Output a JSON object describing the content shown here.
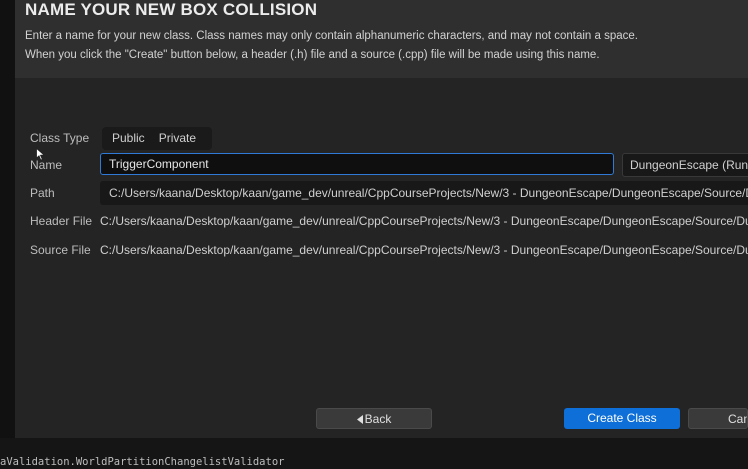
{
  "dialog": {
    "title": "NAME YOUR NEW BOX COLLISION",
    "description_line1": "Enter a name for your new class. Class names may only contain alphanumeric characters, and may not contain a space.",
    "description_line2": "When you click the \"Create\" button below, a header (.h) file and a source (.cpp) file will be made using this name."
  },
  "form": {
    "class_type_label": "Class Type",
    "class_type_options": [
      "Public",
      "Private"
    ],
    "name_label": "Name",
    "name_value": "TriggerComponent",
    "module_value": "DungeonEscape (Runtime)",
    "path_label": "Path",
    "path_value": "C:/Users/kaana/Desktop/kaan/game_dev/unreal/CppCourseProjects/New/3 - DungeonEscape/DungeonEscape/Source/DungeonEscape/",
    "header_label": "Header File",
    "header_value": "C:/Users/kaana/Desktop/kaan/game_dev/unreal/CppCourseProjects/New/3 - DungeonEscape/DungeonEscape/Source/DungeonEscape/TriggerComponent.h",
    "source_label": "Source File",
    "source_value": "C:/Users/kaana/Desktop/kaan/game_dev/unreal/CppCourseProjects/New/3 - DungeonEscape/DungeonEscape/Source/DungeonEscape/TriggerComponent.cpp"
  },
  "buttons": {
    "back_label": "Back",
    "create_label": "Create Class",
    "cancel_label": "Cancel"
  },
  "status_bar": {
    "text": "aValidation.WorldPartitionChangelistValidator"
  },
  "icons": {
    "back": "chevron-left-icon",
    "cursor": "mouse-cursor-icon"
  },
  "colors": {
    "accent": "#0e6fd8",
    "focus_border": "#2e7ad6"
  }
}
